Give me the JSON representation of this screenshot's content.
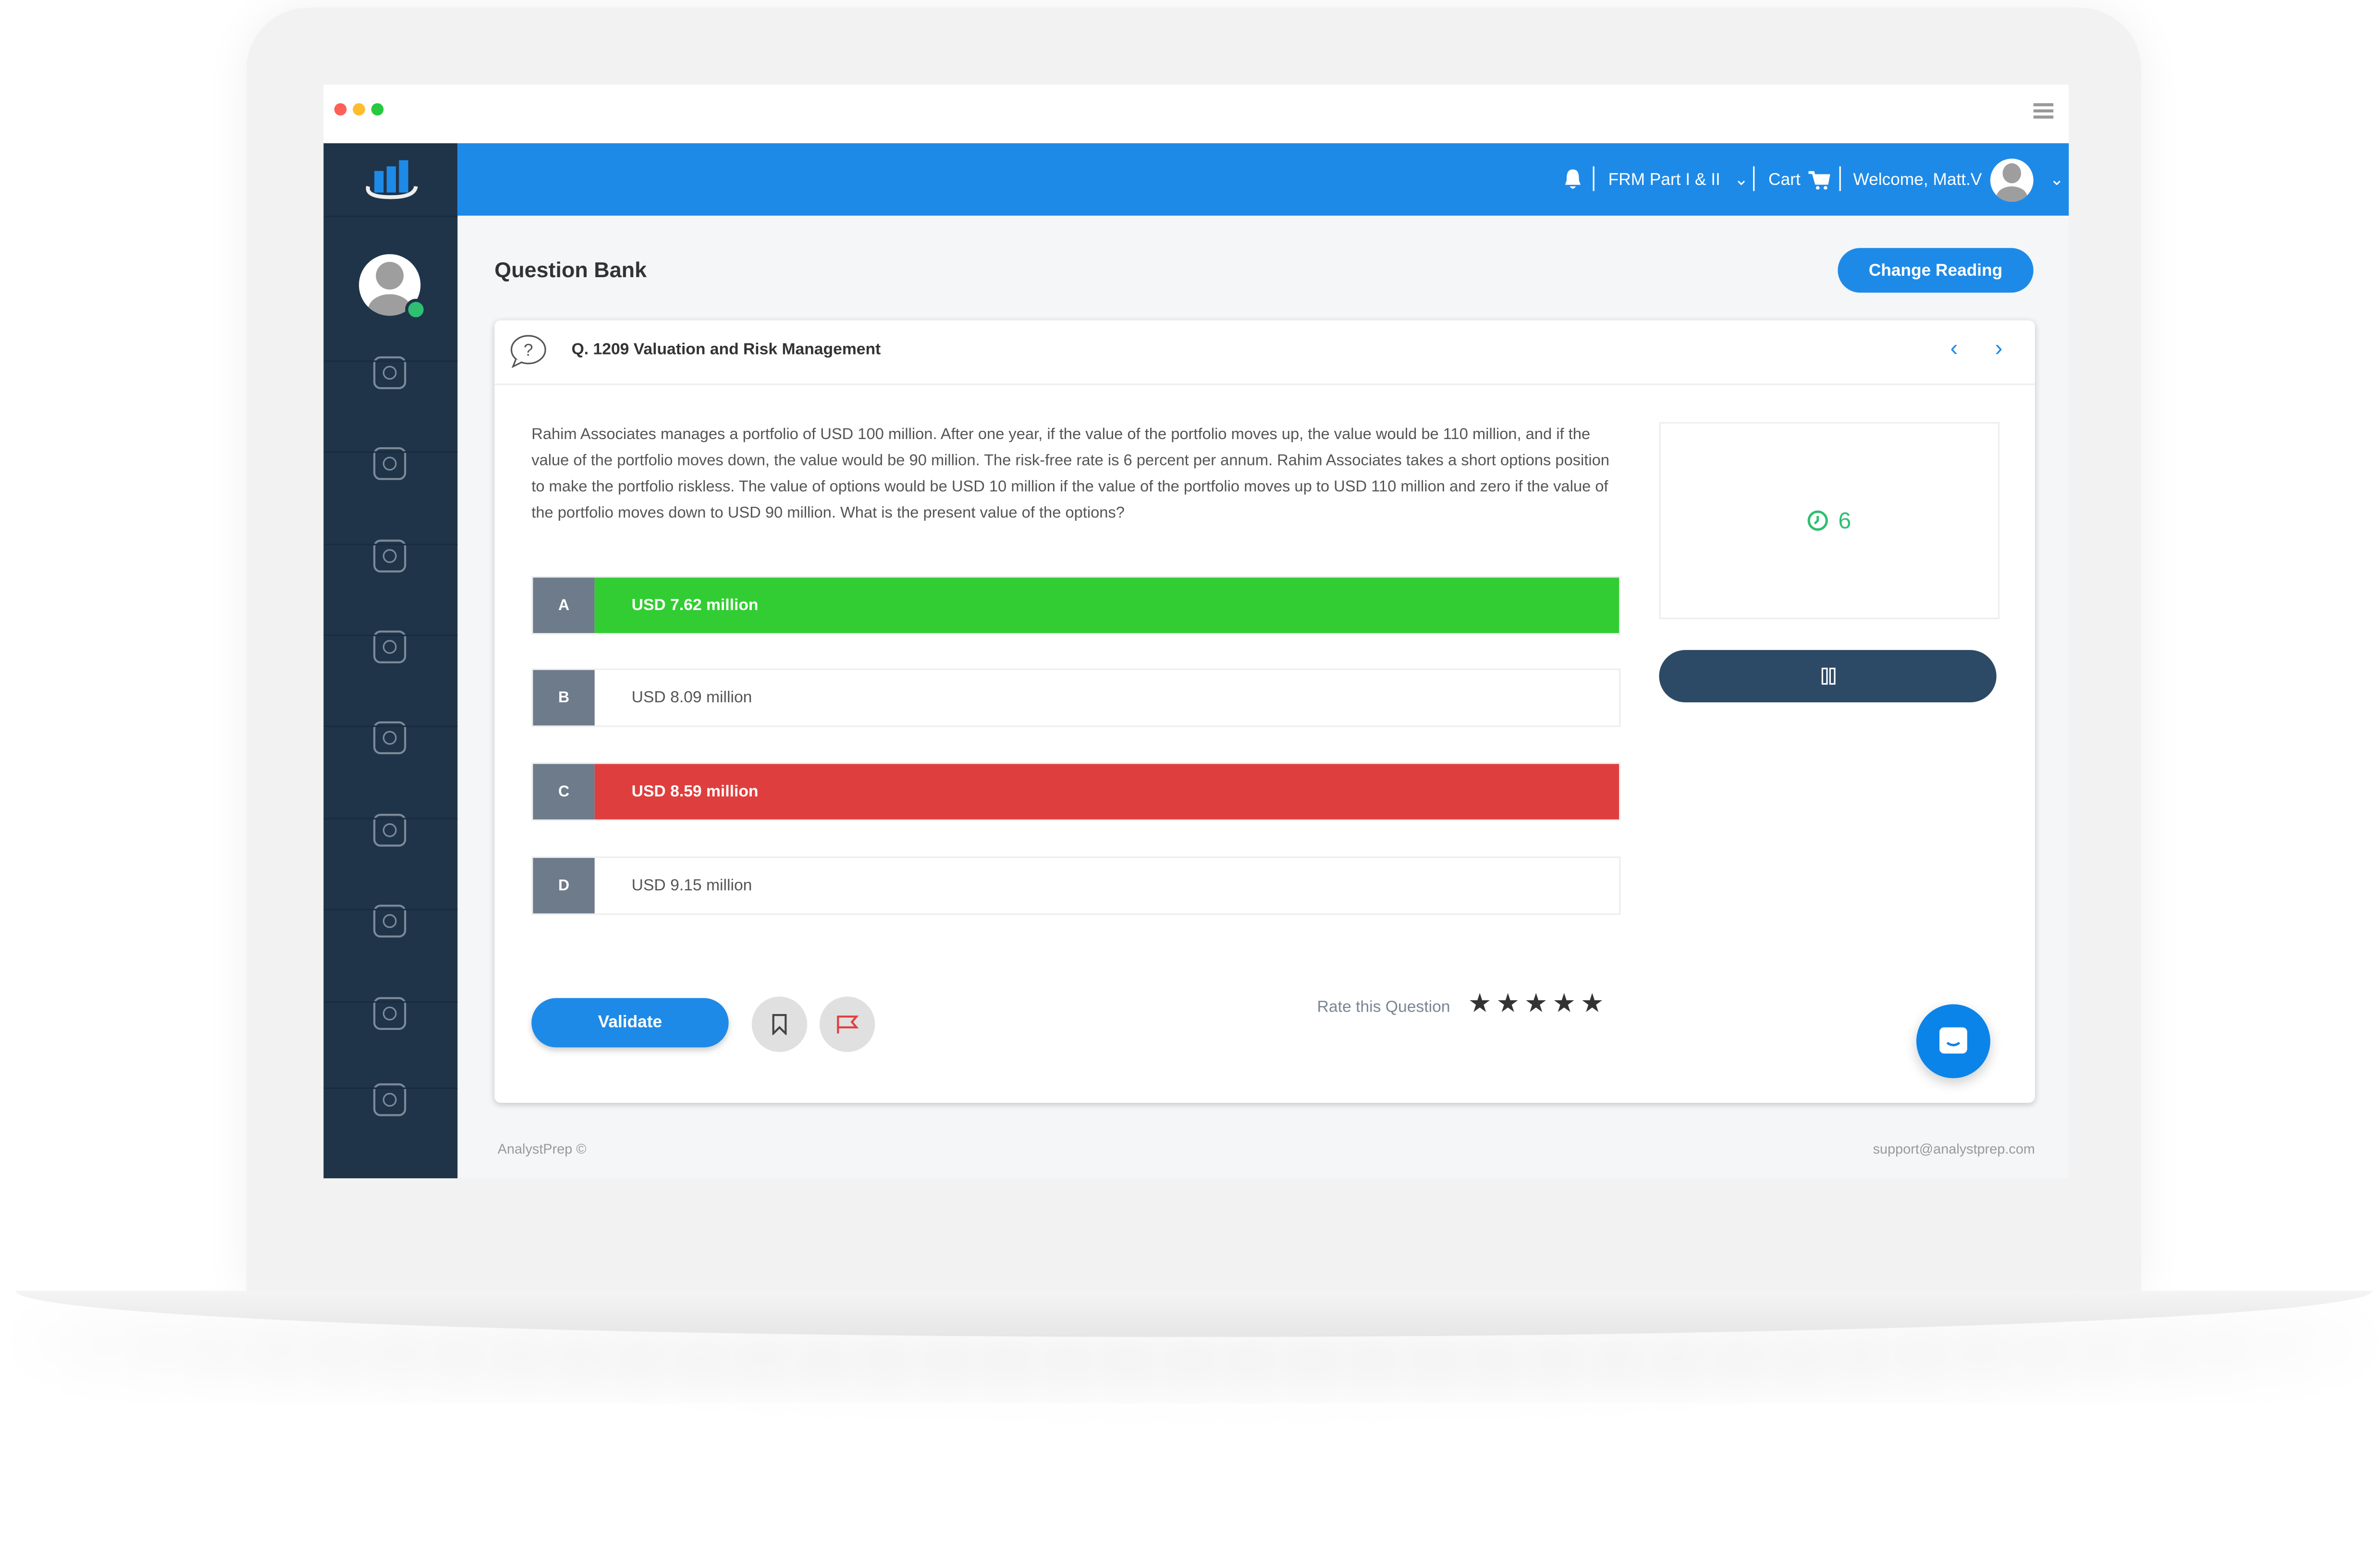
{
  "window": {
    "traffic_lights": [
      "#ff5f57",
      "#febc2e",
      "#28c840"
    ],
    "menu_icon": "hamburger-icon"
  },
  "colors": {
    "brand": "#1e8ae8",
    "sidebar": "#1f3449",
    "correct": "#32cd32",
    "wrong": "#df3e3e",
    "timer": "#2fbf71"
  },
  "sidebar": {
    "items": [
      {
        "icon": "map-icon"
      },
      {
        "icon": "gear-head-icon"
      },
      {
        "icon": "brain-icon"
      },
      {
        "icon": "question-bubble-icon"
      },
      {
        "icon": "graduation-cap-icon"
      },
      {
        "icon": "book-icon"
      },
      {
        "icon": "open-book-icon"
      },
      {
        "icon": "clipboard-icon"
      },
      {
        "icon": "money-hand-icon"
      }
    ]
  },
  "header": {
    "course": "FRM Part I & II",
    "cart": "Cart",
    "welcome": "Welcome, Matt.V"
  },
  "page": {
    "title": "Question Bank",
    "change_reading": "Change Reading"
  },
  "question": {
    "title": "Q. 1209 Valuation and Risk Management",
    "text": "Rahim Associates manages a portfolio of USD 100 million. After one year, if the value of the portfolio moves up, the value would be 110 million, and if the value of the portfolio moves down, the value would be 90 million. The risk-free rate is 6 percent per annum. Rahim Associates takes a short options position to make the portfolio riskless. The value of options would be USD 10 million if the value of the portfolio moves up to USD 110 million and zero if the value of the portfolio moves down to USD 90 million. What is the present value of the options?",
    "options": [
      {
        "letter": "A",
        "text": "USD 7.62 million",
        "state": "correct"
      },
      {
        "letter": "B",
        "text": "USD 8.09 million",
        "state": "none"
      },
      {
        "letter": "C",
        "text": "USD 8.59 million",
        "state": "wrong"
      },
      {
        "letter": "D",
        "text": "USD 9.15 million",
        "state": "none"
      }
    ]
  },
  "timer": {
    "value": "6"
  },
  "actions": {
    "validate": "Validate",
    "rate_label": "Rate this Question",
    "stars": "★★★★★",
    "rating_max": 5
  },
  "footer": {
    "left": "AnalystPrep ©",
    "right": "support@analystprep.com"
  }
}
